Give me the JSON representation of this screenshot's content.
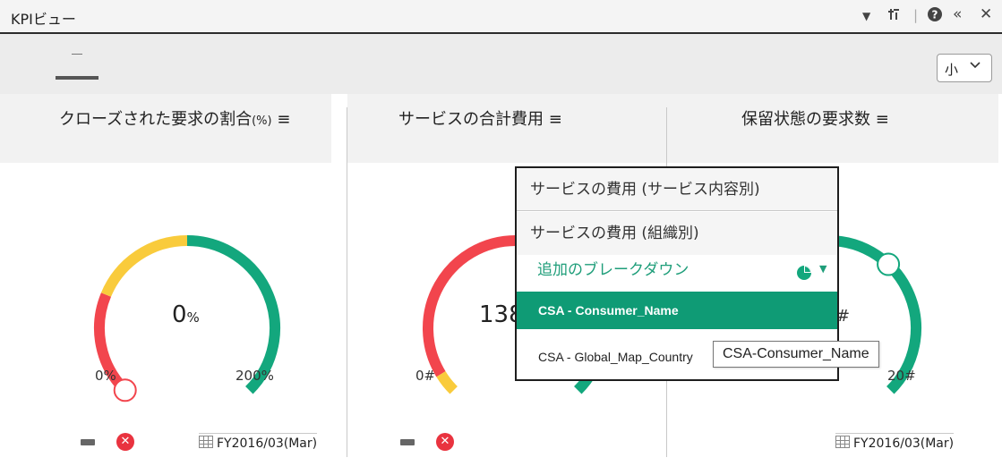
{
  "window": {
    "title": "KPIビュー",
    "icons": [
      "dropdown-arrow-icon",
      "customize-icon",
      "help-icon",
      "collapse-icon",
      "close-icon"
    ]
  },
  "toolbar": {
    "size_select": {
      "value": "小"
    }
  },
  "panels": [
    {
      "title": "クローズされた要求の割合",
      "unit": "(%)",
      "gauge": {
        "value_text": "0",
        "value_suffix": "%",
        "min_label": "0%",
        "max_label": "200%",
        "value_fraction": 0
      },
      "date": "FY2016/03(Mar)"
    },
    {
      "title": "サービスの合計費用",
      "gauge": {
        "value_text": "138",
        "min_label": "0#"
      }
    },
    {
      "title": "保留状態の要求数",
      "gauge": {
        "value_suffix": "#",
        "max_label": "20#",
        "value_fraction": 0.66
      },
      "date": "FY2016/03(Mar)"
    }
  ],
  "dropdown": {
    "items": [
      "サービスの費用 (サービス内容別)",
      "サービスの費用 (組織別)"
    ],
    "additional_breakdown": "追加のブレークダウン",
    "options": [
      "CSA - Consumer_Name",
      "CSA - Global_Map_Country"
    ],
    "selected_index": 0
  },
  "tooltip": "CSA-Consumer_Name",
  "colors": {
    "red": "#f2454d",
    "yellow": "#f9cb3c",
    "green": "#13a77d",
    "selected": "#0f9b75"
  }
}
